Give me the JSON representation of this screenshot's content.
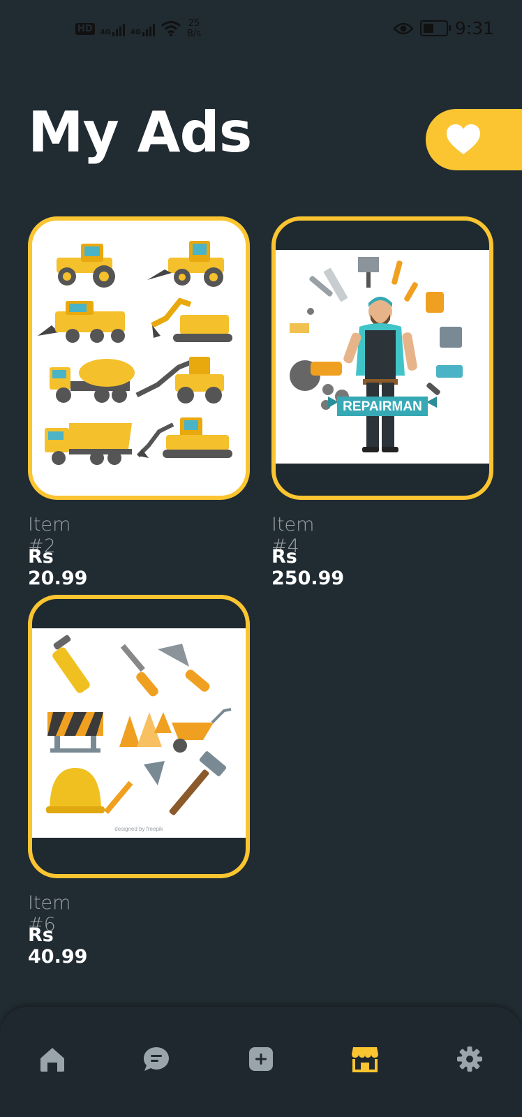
{
  "status_bar": {
    "left_badge": "HD",
    "sim1": "4G",
    "sim2": "4G",
    "speed_value": "25",
    "speed_unit": "B/s",
    "time": "9:31"
  },
  "page": {
    "title": "My Ads"
  },
  "ads": [
    {
      "title": "Item #2",
      "price": "Rs 20.99",
      "image": "construction-vehicles-illustration"
    },
    {
      "title": "Item #4",
      "price": "Rs 250.99",
      "image": "repairman-illustration",
      "image_text": "REPAIRMAN"
    },
    {
      "title": "Item #6",
      "price": "Rs 40.99",
      "image": "construction-tools-illustration",
      "image_text": "designed by freepik"
    }
  ],
  "colors": {
    "background": "#212b32",
    "accent": "#fbc531",
    "muted": "#9aa1a6",
    "nav_icon": "#9aa4ab"
  },
  "bottom_nav": {
    "items": [
      {
        "icon": "home-icon",
        "active": false
      },
      {
        "icon": "chat-icon",
        "active": false
      },
      {
        "icon": "add-icon",
        "active": false
      },
      {
        "icon": "store-icon",
        "active": true
      },
      {
        "icon": "settings-icon",
        "active": false
      }
    ]
  }
}
